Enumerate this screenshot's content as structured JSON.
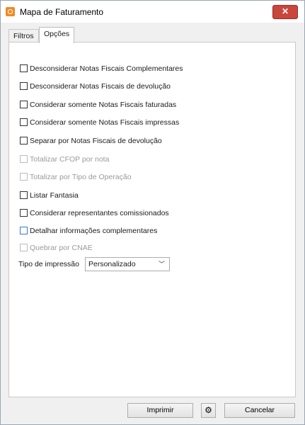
{
  "window": {
    "title": "Mapa de Faturamento",
    "close": "✕"
  },
  "tabs": [
    {
      "label": "Filtros"
    },
    {
      "label": "Opções"
    }
  ],
  "options": [
    {
      "label": "Desconsiderar Notas Fiscais Complementares",
      "checked": false,
      "enabled": true
    },
    {
      "label": "Desconsiderar Notas Fiscais de devolução",
      "checked": false,
      "enabled": true
    },
    {
      "label": "Considerar somente Notas Fiscais faturadas",
      "checked": false,
      "enabled": true
    },
    {
      "label": "Considerar somente Notas Fiscais impressas",
      "checked": false,
      "enabled": true
    },
    {
      "label": "Separar por Notas Fiscais de devolução",
      "checked": false,
      "enabled": true
    },
    {
      "label": "Totalizar CFOP por nota",
      "checked": false,
      "enabled": false
    },
    {
      "label": "Totalizar por Tipo de Operação",
      "checked": false,
      "enabled": false
    },
    {
      "label": "Listar Fantasia",
      "checked": false,
      "enabled": true
    },
    {
      "label": "Considerar representantes comissionados",
      "checked": false,
      "enabled": true
    },
    {
      "label": "Detalhar informações complementares",
      "checked": false,
      "enabled": true
    },
    {
      "label": "Quebrar por CNAE",
      "checked": false,
      "enabled": false
    }
  ],
  "print_type": {
    "label": "Tipo de impressão",
    "value": "Personalizado",
    "chevron": "﹀"
  },
  "buttons": {
    "print": "Imprimir",
    "gear": "⚙",
    "cancel": "Cancelar"
  }
}
